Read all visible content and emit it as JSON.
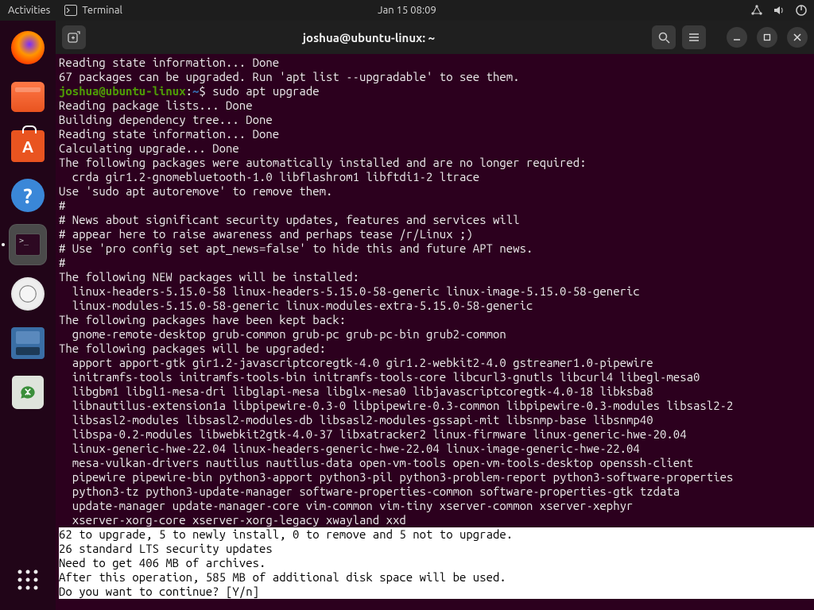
{
  "topbar": {
    "activities": "Activities",
    "app_label": "Terminal",
    "clock": "Jan 15  08:09"
  },
  "dock": {
    "items": [
      {
        "name": "firefox"
      },
      {
        "name": "files"
      },
      {
        "name": "software"
      },
      {
        "name": "help"
      },
      {
        "name": "terminal"
      },
      {
        "name": "disc"
      },
      {
        "name": "disks"
      },
      {
        "name": "trash"
      }
    ]
  },
  "window": {
    "title": "joshua@ubuntu-linux: ~"
  },
  "prompt": {
    "user": "joshua@ubuntu-linux",
    "path": "~",
    "sep": ":",
    "sigil": "$",
    "command": "sudo apt upgrade"
  },
  "lines": {
    "l0": "Reading state information... Done",
    "l1": "67 packages can be upgraded. Run 'apt list --upgradable' to see them.",
    "l2": "Reading package lists... Done",
    "l3": "Building dependency tree... Done",
    "l4": "Reading state information... Done",
    "l5": "Calculating upgrade... Done",
    "l6": "The following packages were automatically installed and are no longer required:",
    "l7": "  crda gir1.2-gnomebluetooth-1.0 libflashrom1 libftdi1-2 ltrace",
    "l8": "Use 'sudo apt autoremove' to remove them.",
    "l9": "#",
    "l10": "# News about significant security updates, features and services will",
    "l11": "# appear here to raise awareness and perhaps tease /r/Linux ;)",
    "l12": "# Use 'pro config set apt_news=false' to hide this and future APT news.",
    "l13": "#",
    "l14": "The following NEW packages will be installed:",
    "l15": "  linux-headers-5.15.0-58 linux-headers-5.15.0-58-generic linux-image-5.15.0-58-generic",
    "l16": "  linux-modules-5.15.0-58-generic linux-modules-extra-5.15.0-58-generic",
    "l17": "The following packages have been kept back:",
    "l18": "  gnome-remote-desktop grub-common grub-pc grub-pc-bin grub2-common",
    "l19": "The following packages will be upgraded:",
    "l20": "  apport apport-gtk gir1.2-javascriptcoregtk-4.0 gir1.2-webkit2-4.0 gstreamer1.0-pipewire",
    "l21": "  initramfs-tools initramfs-tools-bin initramfs-tools-core libcurl3-gnutls libcurl4 libegl-mesa0",
    "l22": "  libgbm1 libgl1-mesa-dri libglapi-mesa libglx-mesa0 libjavascriptcoregtk-4.0-18 libksba8",
    "l23": "  libnautilus-extension1a libpipewire-0.3-0 libpipewire-0.3-common libpipewire-0.3-modules libsasl2-2",
    "l24": "  libsasl2-modules libsasl2-modules-db libsasl2-modules-gssapi-mit libsnmp-base libsnmp40",
    "l25": "  libspa-0.2-modules libwebkit2gtk-4.0-37 libxatracker2 linux-firmware linux-generic-hwe-20.04",
    "l26": "  linux-generic-hwe-22.04 linux-headers-generic-hwe-22.04 linux-image-generic-hwe-22.04",
    "l27": "  mesa-vulkan-drivers nautilus nautilus-data open-vm-tools open-vm-tools-desktop openssh-client",
    "l28": "  pipewire pipewire-bin python3-apport python3-pil python3-problem-report python3-software-properties",
    "l29": "  python3-tz python3-update-manager software-properties-common software-properties-gtk tzdata",
    "l30": "  update-manager update-manager-core vim-common vim-tiny xserver-common xserver-xephyr",
    "l31": "  xserver-xorg-core xserver-xorg-legacy xwayland xxd"
  },
  "highlight": {
    "h0": "62 to upgrade, 5 to newly install, 0 to remove and 5 not to upgrade.",
    "h1": "26 standard LTS security updates",
    "h2": "Need to get 406 MB of archives.",
    "h3": "After this operation, 585 MB of additional disk space will be used.",
    "h4": "Do you want to continue? [Y/n] "
  }
}
